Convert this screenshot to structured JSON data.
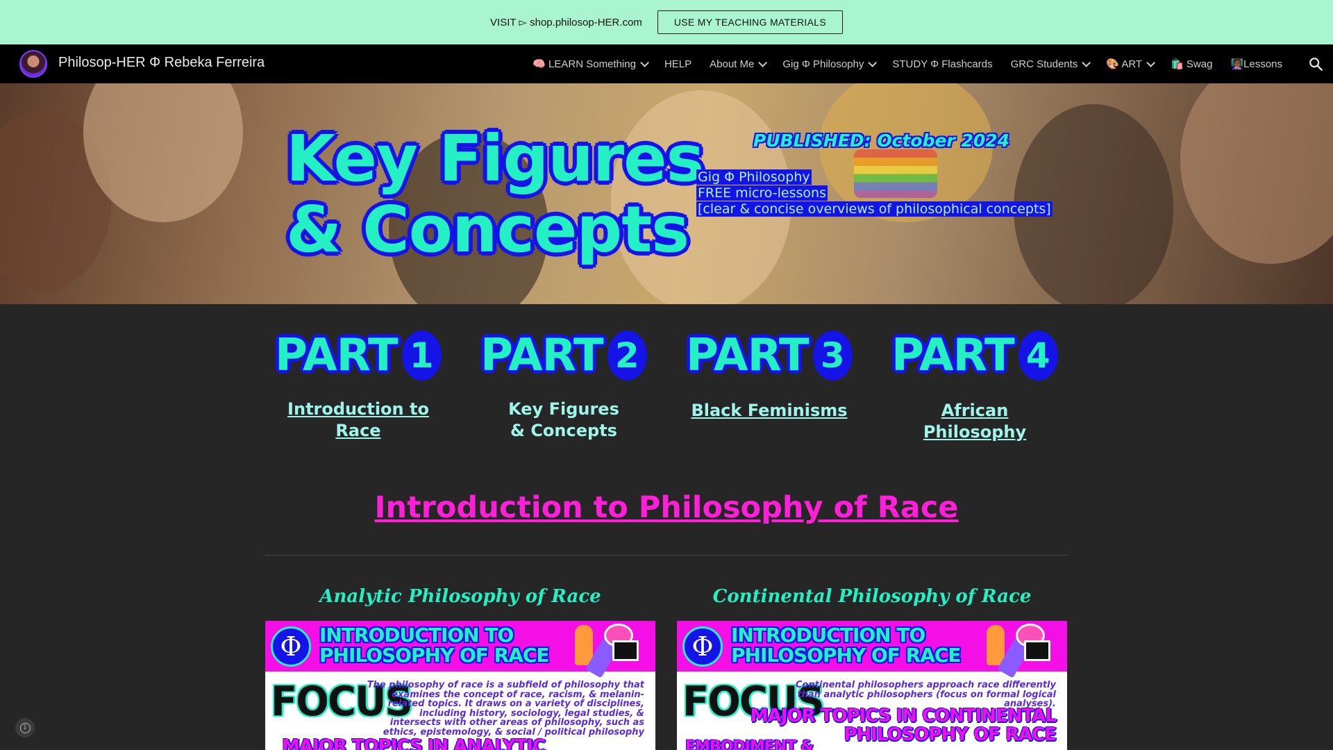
{
  "topbar": {
    "visit_text": "VISIT ▻ shop.philosop-HER.com",
    "button_label": "USE MY TEACHING MATERIALS"
  },
  "nav": {
    "site_title": "Philosop-HER Φ Rebeka Ferreira",
    "items": [
      {
        "label": "🧠 LEARN Something",
        "dropdown": true
      },
      {
        "label": "HELP",
        "dropdown": false
      },
      {
        "label": "About Me",
        "dropdown": true
      },
      {
        "label": "Gig Φ Philosophy",
        "dropdown": true
      },
      {
        "label": "STUDY Φ Flashcards",
        "dropdown": false
      },
      {
        "label": "GRC Students",
        "dropdown": true
      },
      {
        "label": "🎨 ART",
        "dropdown": true
      },
      {
        "label": "🛍️ Swag",
        "dropdown": false
      },
      {
        "label": "👩🏾‍🏫Lessons",
        "dropdown": false
      }
    ],
    "search_icon": "search-icon"
  },
  "hero": {
    "title_line1": "Key Figures",
    "title_line2": "& Concepts",
    "published": "PUBLISHED: October 2024",
    "sub_line1": "Gig Φ Philosophy",
    "sub_line2": "FREE micro-lessons",
    "sub_line3": "[clear & concise overviews of philosophical concepts]"
  },
  "parts": [
    {
      "word": "PART",
      "number": "1",
      "link": "Introduction to Race",
      "linked": true
    },
    {
      "word": "PART",
      "number": "2",
      "link": "Key Figures & Concepts",
      "linked": false
    },
    {
      "word": "PART",
      "number": "3",
      "link": "Black Feminisms",
      "linked": true
    },
    {
      "word": "PART",
      "number": "4",
      "link": "African Philosophy",
      "linked": true
    }
  ],
  "section": {
    "title": "Introduction to Philosophy of Race"
  },
  "columns": [
    {
      "title": "Analytic Philosophy of Race",
      "banner_phi": "Φ",
      "banner_line1": "INTRODUCTION TO",
      "banner_line2": "PHILOSOPHY OF RACE",
      "focus": "FOCUS",
      "desc": "The philosophy of race is a subfield of philosophy that examines the concept of race, racism, & melanin-related topics. It draws on a variety of disciplines, including history, sociology, legal studies, & intersects with other areas of philosophy, such as ethics, epistemology, & social / political philosophy",
      "major": "MAJOR TOPICS IN ANALYTIC"
    },
    {
      "title": "Continental Philosophy of Race",
      "banner_phi": "Φ",
      "banner_line1": "INTRODUCTION TO",
      "banner_line2": "PHILOSOPHY OF RACE",
      "focus": "FOCUS",
      "desc": "Continental philosophers approach race differently than analytic philosophers (focus on formal logical analyses).",
      "major_line1": "MAJOR TOPICS IN CONTINENTAL",
      "major_line2": "PHILOSOPHY OF RACE",
      "embodiment": "EMBODIMENT &"
    }
  ],
  "colors": {
    "topbar_bg": "#a8f5cf",
    "accent_cyan": "#25f0c4",
    "accent_blue": "#1414e6",
    "accent_magenta": "#ff1fd9",
    "page_bg": "#262626"
  }
}
